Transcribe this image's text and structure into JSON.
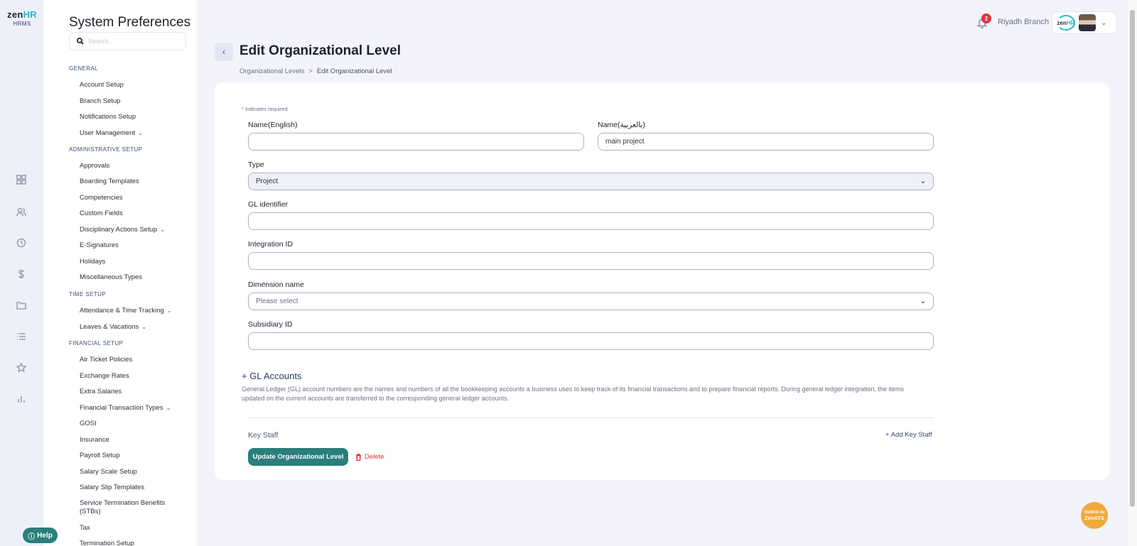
{
  "app": {
    "logo_main": "zen",
    "logo_accent": "HR",
    "logo_sub": "HRMS"
  },
  "help": {
    "label": "Help"
  },
  "sidebar": {
    "title": "System Preferences",
    "search_placeholder": "Search...",
    "sections": [
      {
        "label": "GENERAL"
      },
      {
        "label": "ADMINISTRATIVE SETUP"
      },
      {
        "label": "TIME SETUP"
      },
      {
        "label": "FINANCIAL SETUP"
      }
    ],
    "items": [
      {
        "label": "Account Setup"
      },
      {
        "label": "Branch Setup"
      },
      {
        "label": "Notifications Setup"
      },
      {
        "label": "User Management"
      },
      {
        "label": "Approvals"
      },
      {
        "label": "Boarding Templates"
      },
      {
        "label": "Competencies"
      },
      {
        "label": "Custom Fields"
      },
      {
        "label": "Disciplinary Actions Setup"
      },
      {
        "label": "E-Signatures"
      },
      {
        "label": "Holidays"
      },
      {
        "label": "Miscellaneous Types"
      },
      {
        "label": "Attendance & Time Tracking"
      },
      {
        "label": "Leaves & Vacations"
      },
      {
        "label": "Air Ticket Policies"
      },
      {
        "label": "Exchange Rates"
      },
      {
        "label": "Extra Salaries"
      },
      {
        "label": "Financial Transaction Types"
      },
      {
        "label": "GOSI"
      },
      {
        "label": "Insurance"
      },
      {
        "label": "Payroll Setup"
      },
      {
        "label": "Salary Scale Setup"
      },
      {
        "label": "Salary Slip Templates"
      },
      {
        "label": "Service Termination Benefits (STBs)"
      },
      {
        "label": "Tax"
      },
      {
        "label": "Termination Setup"
      }
    ]
  },
  "topbar": {
    "notification_count": "2",
    "branch": "Riyadh Branch",
    "user_logo_main": "zen",
    "user_logo_accent": "HR"
  },
  "page": {
    "title": "Edit Organizational Level",
    "breadcrumb": [
      "Organizational Levels",
      ">",
      "Edit Organizational Level"
    ]
  },
  "form": {
    "required_note": "* Indicates required",
    "name_en": {
      "label": "Name(English)",
      "value": ""
    },
    "name_ar": {
      "label": "Name(بالعربية)",
      "value": "main project"
    },
    "type": {
      "label": "Type",
      "value": "Project"
    },
    "gl_identifier": {
      "label": "GL identifier",
      "value": ""
    },
    "integration_id": {
      "label": "Integration ID",
      "value": ""
    },
    "dimension_name": {
      "label": "Dimension name",
      "value": "Please select"
    },
    "subsidiary_id": {
      "label": "Subsidiary ID",
      "value": ""
    }
  },
  "gl_accounts": {
    "title": "+ GL Accounts",
    "description": "General Ledger (GL) account numbers are the names and numbers of all the bookkeeping accounts a business uses to keep track of its financial transactions and to prepare financial reports. During general ledger integration, the items updated on the current accounts are transferred to the corresponding general ledger accounts."
  },
  "key_staff": {
    "label": "Key Staff",
    "add_label": "+ Add Key Staff"
  },
  "actions": {
    "update_label": "Update Organizational Level",
    "delete_label": "Delete"
  },
  "switch_ats": {
    "line1": "Switch to",
    "line2": "ZenATS"
  },
  "colors": {
    "accent": "#2a7f7c",
    "danger": "#e0323c",
    "brand_teal": "#2bb7c4",
    "ats_orange": "#f2a93b"
  }
}
